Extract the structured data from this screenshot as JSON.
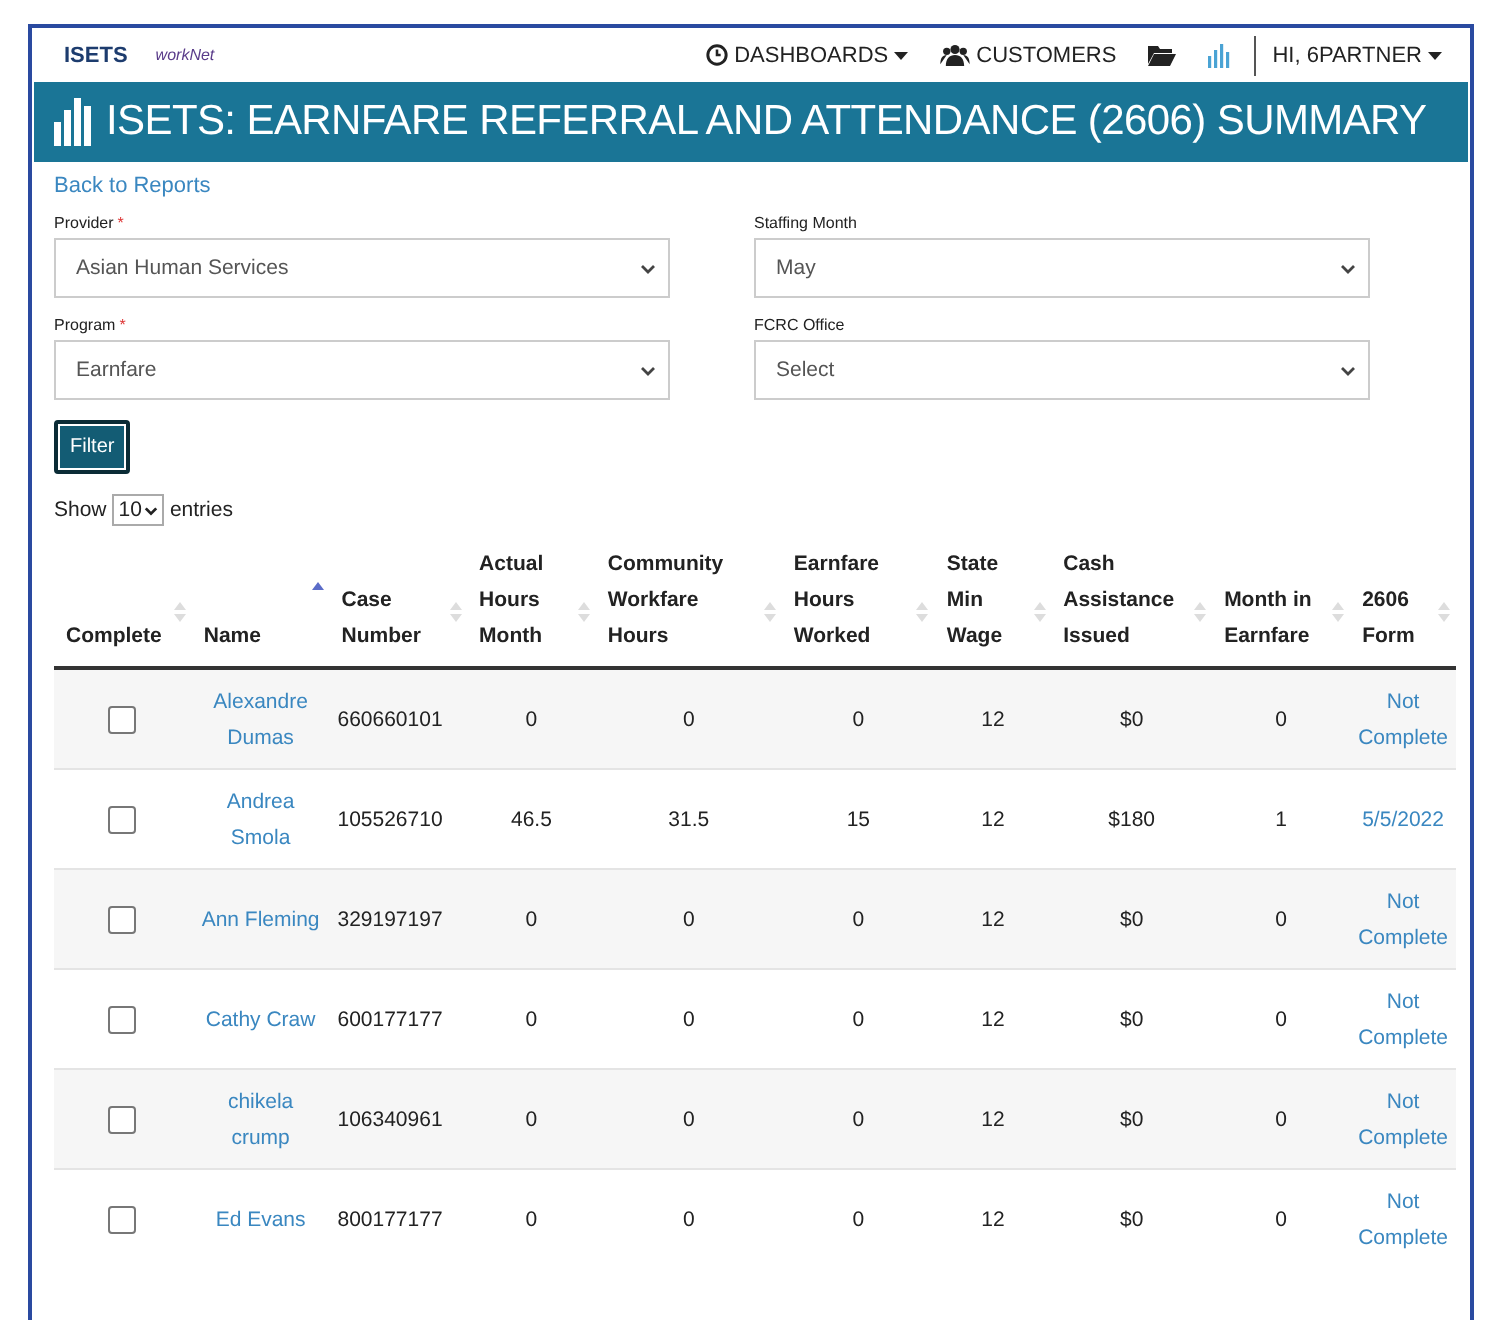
{
  "header": {
    "logo": "ISETS",
    "partner_logo": "workNet",
    "nav": [
      {
        "kind": "menu",
        "label": "DASHBOARDS"
      },
      {
        "kind": "link",
        "label": "CUSTOMERS"
      },
      {
        "kind": "icon"
      },
      {
        "kind": "icon"
      },
      {
        "kind": "menu",
        "label": "HI, 6PARTNER"
      }
    ]
  },
  "banner": {
    "title": "ISETS: EARNFARE REFERRAL AND ATTENDANCE (2606) SUMMARY"
  },
  "back_link": "Back to Reports",
  "filters": [
    {
      "label": "Provider",
      "required_mark": "*",
      "value": "Asian Human Services"
    },
    {
      "label": "Staffing Month",
      "value": "May"
    },
    {
      "label": "Program",
      "required_mark": "*",
      "value": "Earnfare"
    },
    {
      "label": "FCRC Office",
      "value": "Select"
    }
  ],
  "filter_button": "Filter",
  "page_length": {
    "before": "Show",
    "value": "10",
    "after": "entries"
  },
  "table": {
    "columns": [
      {
        "label": "Complete",
        "sorted": false
      },
      {
        "label": "Name",
        "sorted": true
      },
      {
        "label": "Case Number",
        "sorted": false
      },
      {
        "label": "Actual Hours Month",
        "sorted": false
      },
      {
        "label": "Community Workfare Hours",
        "sorted": false
      },
      {
        "label": "Earnfare Hours Worked",
        "sorted": false
      },
      {
        "label": "State Min Wage",
        "sorted": false
      },
      {
        "label": "Cash Assistance Issued",
        "sorted": false
      },
      {
        "label": "Month in Earnfare",
        "sorted": false
      },
      {
        "label": "2606 Form",
        "sorted": false
      }
    ],
    "rows": [
      {
        "checked": false,
        "name": "Alexandre Dumas",
        "case": "660660101",
        "actual": "0",
        "community": "0",
        "earnfare": "0",
        "wage": "12",
        "cash": "$0",
        "month": "0",
        "form": "Not Complete"
      },
      {
        "checked": false,
        "name": "Andrea Smola",
        "case": "105526710",
        "actual": "46.5",
        "community": "31.5",
        "earnfare": "15",
        "wage": "12",
        "cash": "$180",
        "month": "1",
        "form": "5/5/2022"
      },
      {
        "checked": false,
        "name": "Ann Fleming",
        "case": "329197197",
        "actual": "0",
        "community": "0",
        "earnfare": "0",
        "wage": "12",
        "cash": "$0",
        "month": "0",
        "form": "Not Complete"
      },
      {
        "checked": false,
        "name": "Cathy Craw",
        "case": "600177177",
        "actual": "0",
        "community": "0",
        "earnfare": "0",
        "wage": "12",
        "cash": "$0",
        "month": "0",
        "form": "Not Complete"
      },
      {
        "checked": false,
        "name": "chikela crump",
        "case": "106340961",
        "actual": "0",
        "community": "0",
        "earnfare": "0",
        "wage": "12",
        "cash": "$0",
        "month": "0",
        "form": "Not Complete"
      },
      {
        "checked": false,
        "name": "Ed Evans",
        "case": "800177177",
        "actual": "0",
        "community": "0",
        "earnfare": "0",
        "wage": "12",
        "cash": "$0",
        "month": "0",
        "form": "Not Complete"
      }
    ]
  }
}
